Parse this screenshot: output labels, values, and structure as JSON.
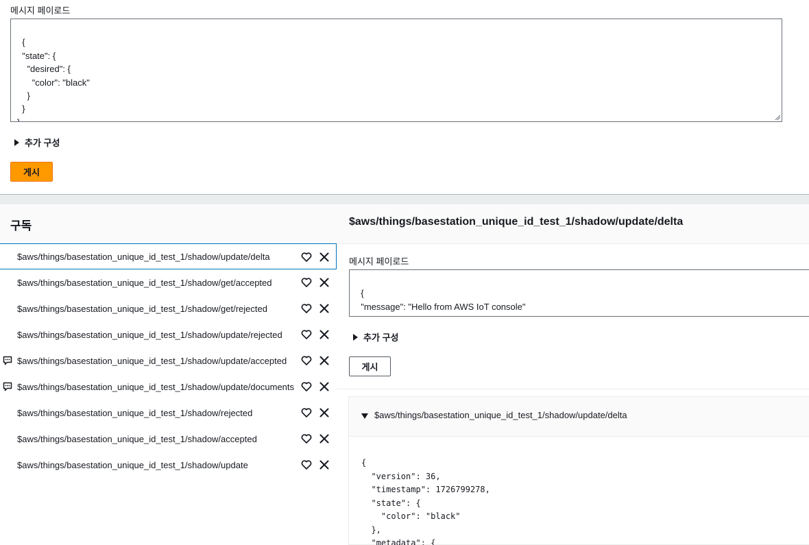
{
  "publish": {
    "payload_label": "메시지 페이로드",
    "payload_text": "{\n  \"state\": {\n    \"desired\": {\n      \"color\": \"black\"\n    }\n  }\n}",
    "additional_config_label": "추가 구성",
    "publish_button": "게시"
  },
  "subscriptions": {
    "title": "구독",
    "topics": [
      {
        "name": "$aws/things/basestation_unique_id_test_1/shadow/update/delta",
        "selected": true,
        "has_message_icon": false
      },
      {
        "name": "$aws/things/basestation_unique_id_test_1/shadow/get/accepted",
        "selected": false,
        "has_message_icon": false
      },
      {
        "name": "$aws/things/basestation_unique_id_test_1/shadow/get/rejected",
        "selected": false,
        "has_message_icon": false
      },
      {
        "name": "$aws/things/basestation_unique_id_test_1/shadow/update/rejected",
        "selected": false,
        "has_message_icon": false
      },
      {
        "name": "$aws/things/basestation_unique_id_test_1/shadow/update/accepted",
        "selected": false,
        "has_message_icon": true
      },
      {
        "name": "$aws/things/basestation_unique_id_test_1/shadow/update/documents",
        "selected": false,
        "has_message_icon": true
      },
      {
        "name": "$aws/things/basestation_unique_id_test_1/shadow/rejected",
        "selected": false,
        "has_message_icon": false
      },
      {
        "name": "$aws/things/basestation_unique_id_test_1/shadow/accepted",
        "selected": false,
        "has_message_icon": false
      },
      {
        "name": "$aws/things/basestation_unique_id_test_1/shadow/update",
        "selected": false,
        "has_message_icon": false
      }
    ]
  },
  "detail": {
    "topic_title": "$aws/things/basestation_unique_id_test_1/shadow/update/delta",
    "payload_label": "메시지 페이로드",
    "payload_text": "{\n  \"message\": \"Hello from AWS IoT console\"\n}",
    "additional_config_label": "추가 구성",
    "publish_button": "게시",
    "message": {
      "topic": "$aws/things/basestation_unique_id_test_1/shadow/update/delta",
      "body": "{\n  \"version\": 36,\n  \"timestamp\": 1726799278,\n  \"state\": {\n    \"color\": \"black\"\n  },\n  \"metadata\": {"
    }
  },
  "colors": {
    "primary_button": "#ff9900",
    "selected_border": "#0073bb",
    "text": "#16191f"
  }
}
